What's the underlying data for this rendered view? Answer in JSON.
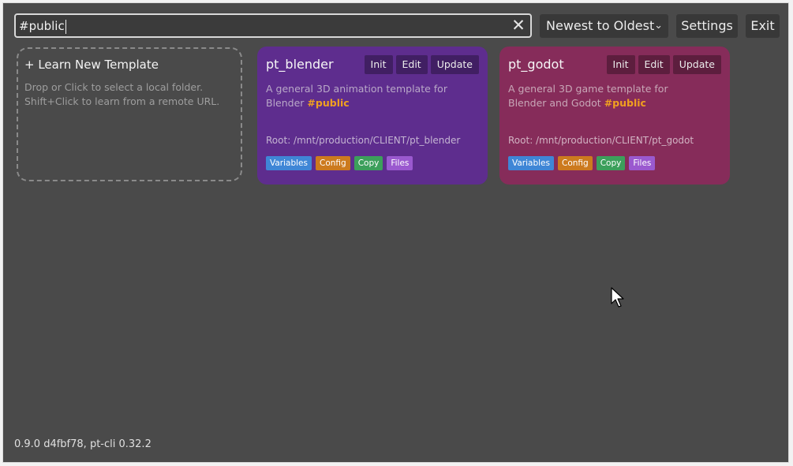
{
  "search": {
    "value": "#public",
    "clear_icon": "close-icon"
  },
  "toolbar": {
    "sort_label": "Newest to Oldest",
    "settings_label": "Settings",
    "exit_label": "Exit"
  },
  "learn": {
    "title": "+ Learn New Template",
    "line1": "Drop or Click to select a local folder.",
    "line2": "Shift+Click to learn from a remote URL."
  },
  "cards": [
    {
      "name": "pt_blender",
      "actions": [
        "Init",
        "Edit",
        "Update"
      ],
      "desc_text": "A general 3D animation template for Blender",
      "tag": "#public",
      "root": "Root: /mnt/production/CLIENT/pt_blender",
      "chips": [
        "Variables",
        "Config",
        "Copy",
        "Files"
      ],
      "color": "#5e2d8e"
    },
    {
      "name": "pt_godot",
      "actions": [
        "Init",
        "Edit",
        "Update"
      ],
      "desc_text": "A general 3D game template for Blender and Godot",
      "tag": "#public",
      "root": "Root: /mnt/production/CLIENT/pt_godot",
      "chips": [
        "Variables",
        "Config",
        "Copy",
        "Files"
      ],
      "color": "#862c5a"
    }
  ],
  "footer": {
    "version": "0.9.0 d4fbf78, pt-cli 0.32.2"
  },
  "colors": {
    "background": "#4a4a4a",
    "tag": "#f0a020"
  }
}
